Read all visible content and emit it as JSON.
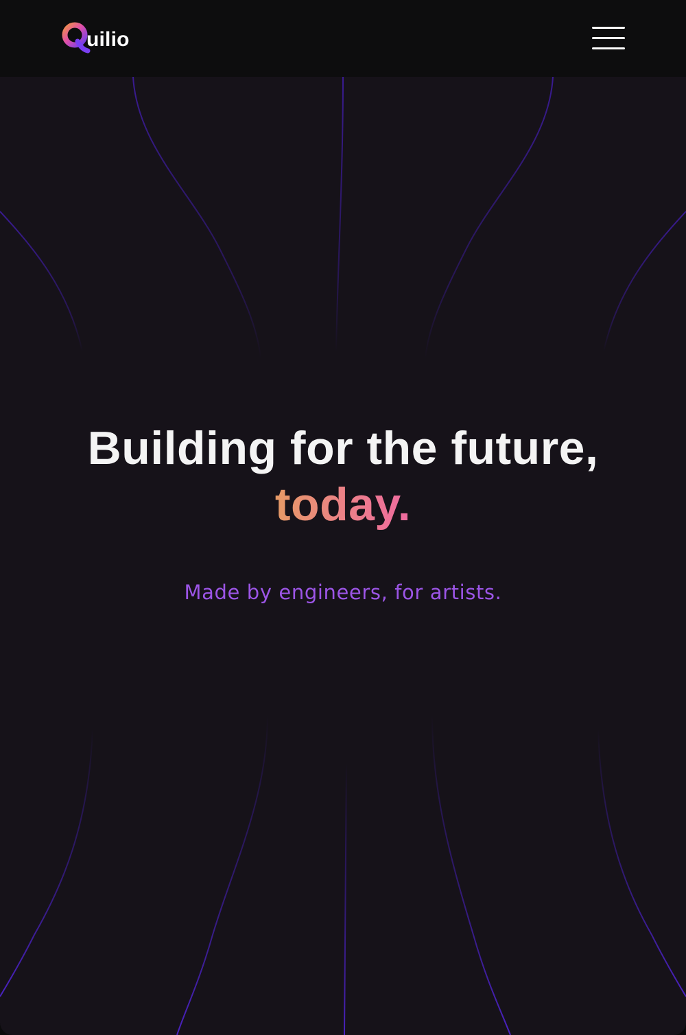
{
  "navbar": {
    "logo_text": "uilio",
    "logo_mark": "Q",
    "menu_icon": "hamburger-menu-icon"
  },
  "hero": {
    "title_line1": "Building for the future,",
    "title_accent": "today.",
    "subtitle": "Made by engineers, for artists."
  },
  "colors": {
    "background": "#161219",
    "navbar": "#0d0d0e",
    "grid_line": "#3a1a8f",
    "title": "#f4f4f4",
    "accent_start": "#e69a66",
    "accent_end": "#ef6aa0",
    "subtitle": "#9c55e6"
  }
}
